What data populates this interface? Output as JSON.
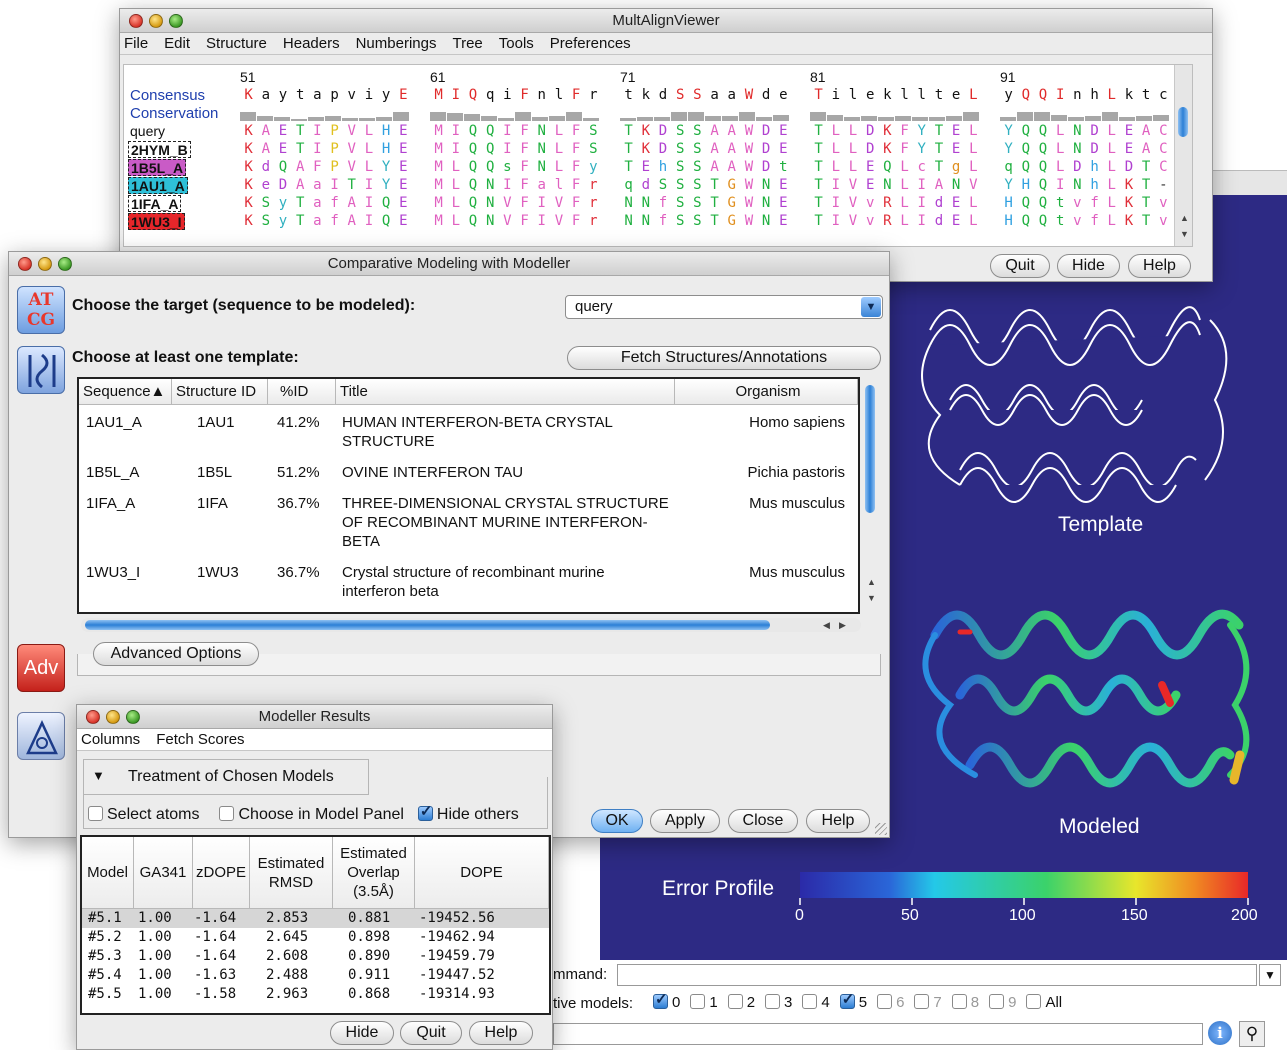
{
  "mav": {
    "title": "MultAlignViewer",
    "menu": [
      "File",
      "Edit",
      "Structure",
      "Headers",
      "Numberings",
      "Tree",
      "Tools",
      "Preferences"
    ],
    "names": [
      "Consensus",
      "Conservation",
      "query",
      "2HYM_B",
      "1B5L_A",
      "1AU1_A",
      "1IFA_A",
      "1WU3_I"
    ],
    "name_colors": [
      "#1f3fae",
      "#1f3fae",
      "#ffffff",
      "#ffffff",
      "#c95bc6",
      "#2ec0d8",
      "#ffffff",
      "#e6262a"
    ],
    "block_numbers": [
      "51",
      "61",
      "71",
      "81",
      "91"
    ],
    "blocks": [
      [
        "KaytapviyE",
        "KAETIPVLHE",
        "KAETIPVLHE",
        "KdQAFPVLYE",
        "KeDAaITIYE",
        "KSyTafAIQE",
        "KSyTafAIQE"
      ],
      [
        "MIQqiFnlFr",
        "MIQQIFNLFS",
        "MIQQIFNLFS",
        "MLQQsFNLFy",
        "MLQNIFalFr",
        "MLQNVFIVFr",
        "MLQNVFIVFr"
      ],
      [
        "tkdSSaaWde",
        "TKDSSAAWDE",
        "TKDSSAAWDE",
        "TEhSSAAWDt",
        "qdSSSTGWNE",
        "NNfSSTGWNE",
        "NNfSSTGWNE"
      ],
      [
        "TilekllteL",
        "TLLDKFYTEL",
        "TLLDKFYTEL",
        "TLLEQLcTgL",
        "TIVENLIANV",
        "TIVvRLIdEL",
        "TIVvRLIdEL"
      ],
      [
        "yQQInhLktc",
        "YQQLNDLEAC",
        "YQQLNDLEAC",
        "qQQLDhLDTC",
        "YHQINhLKT-",
        "HQQtvfLKTv",
        "HQQtvfLKTv"
      ]
    ],
    "buttons": {
      "quit": "Quit",
      "hide": "Hide",
      "help": "Help"
    }
  },
  "modeller": {
    "title": "Comparative Modeling with Modeller",
    "target_label": "Choose the target (sequence to be modeled):",
    "target_value": "query",
    "template_label": "Choose at least one template:",
    "fetch_button": "Fetch Structures/Annotations",
    "columns": [
      "Sequence▲",
      "Structure ID",
      "%ID",
      "Title",
      "Organism"
    ],
    "rows": [
      {
        "seq": "1AU1_A",
        "sid": "1AU1",
        "pid": "41.2%",
        "title1": "HUMAN INTERFERON-BETA CRYSTAL",
        "title2": "STRUCTURE",
        "title3": "",
        "org": "Homo sapiens"
      },
      {
        "seq": "1B5L_A",
        "sid": "1B5L",
        "pid": "51.2%",
        "title1": "OVINE INTERFERON TAU",
        "title2": "",
        "title3": "",
        "org": "Pichia pastoris"
      },
      {
        "seq": "1IFA_A",
        "sid": "1IFA",
        "pid": "36.7%",
        "title1": "THREE-DIMENSIONAL CRYSTAL STRUCTURE",
        "title2": "OF RECOMBINANT MURINE INTERFERON-",
        "title3": "BETA",
        "org": "Mus musculus"
      },
      {
        "seq": "1WU3_I",
        "sid": "1WU3",
        "pid": "36.7%",
        "title1": "Crystal structure of recombinant murine",
        "title2": "interferon beta",
        "title3": "",
        "org": "Mus musculus"
      }
    ],
    "advanced": "Advanced Options",
    "icons": {
      "atcg": "AT CG",
      "adv": "Adv"
    },
    "buttons": {
      "ok": "OK",
      "apply": "Apply",
      "close": "Close",
      "help": "Help"
    }
  },
  "results": {
    "title": "Modeller Results",
    "menu": [
      "Columns",
      "Fetch Scores"
    ],
    "section": "Treatment of Chosen Models",
    "options": [
      {
        "label": "Select atoms",
        "checked": false
      },
      {
        "label": "Choose in Model Panel",
        "checked": false
      },
      {
        "label": "Hide others",
        "checked": true
      }
    ],
    "columns": [
      "Model",
      "GA341",
      "zDOPE",
      "Estimated RMSD",
      "Estimated Overlap (3.5Å)",
      "DOPE"
    ],
    "rows": [
      [
        "#5.1",
        "1.00",
        "-1.64",
        "2.853",
        "0.881",
        "-19452.56"
      ],
      [
        "#5.2",
        "1.00",
        "-1.64",
        "2.645",
        "0.898",
        "-19462.94"
      ],
      [
        "#5.3",
        "1.00",
        "-1.64",
        "2.608",
        "0.890",
        "-19459.79"
      ],
      [
        "#5.4",
        "1.00",
        "-1.63",
        "2.488",
        "0.911",
        "-19447.52"
      ],
      [
        "#5.5",
        "1.00",
        "-1.58",
        "2.963",
        "0.868",
        "-19314.93"
      ]
    ],
    "selected_row": 0,
    "buttons": {
      "hide": "Hide",
      "quit": "Quit",
      "help": "Help"
    }
  },
  "viewer": {
    "template_label": "Template",
    "modeled_label": "Modeled",
    "error_profile": "Error Profile",
    "ticks": [
      "0",
      "50",
      "100",
      "150",
      "200"
    ],
    "command_label": "mmand:",
    "active_label": "tive models:",
    "models": [
      {
        "label": "0",
        "checked": true
      },
      {
        "label": "1",
        "checked": false
      },
      {
        "label": "2",
        "checked": false
      },
      {
        "label": "3",
        "checked": false
      },
      {
        "label": "4",
        "checked": false
      },
      {
        "label": "5",
        "checked": true
      },
      {
        "label": "6",
        "checked": false
      },
      {
        "label": "7",
        "checked": false
      },
      {
        "label": "8",
        "checked": false
      },
      {
        "label": "9",
        "checked": false
      },
      {
        "label": "All",
        "checked": false
      }
    ]
  },
  "colors": {
    "viewer_bg": "#2d2a84",
    "accent": "#2d7dd2"
  },
  "icon_names": [
    "atcg-icon",
    "template-icon",
    "adv-icon",
    "results-icon",
    "info-icon",
    "search-icon",
    "sort-ascending-icon"
  ]
}
